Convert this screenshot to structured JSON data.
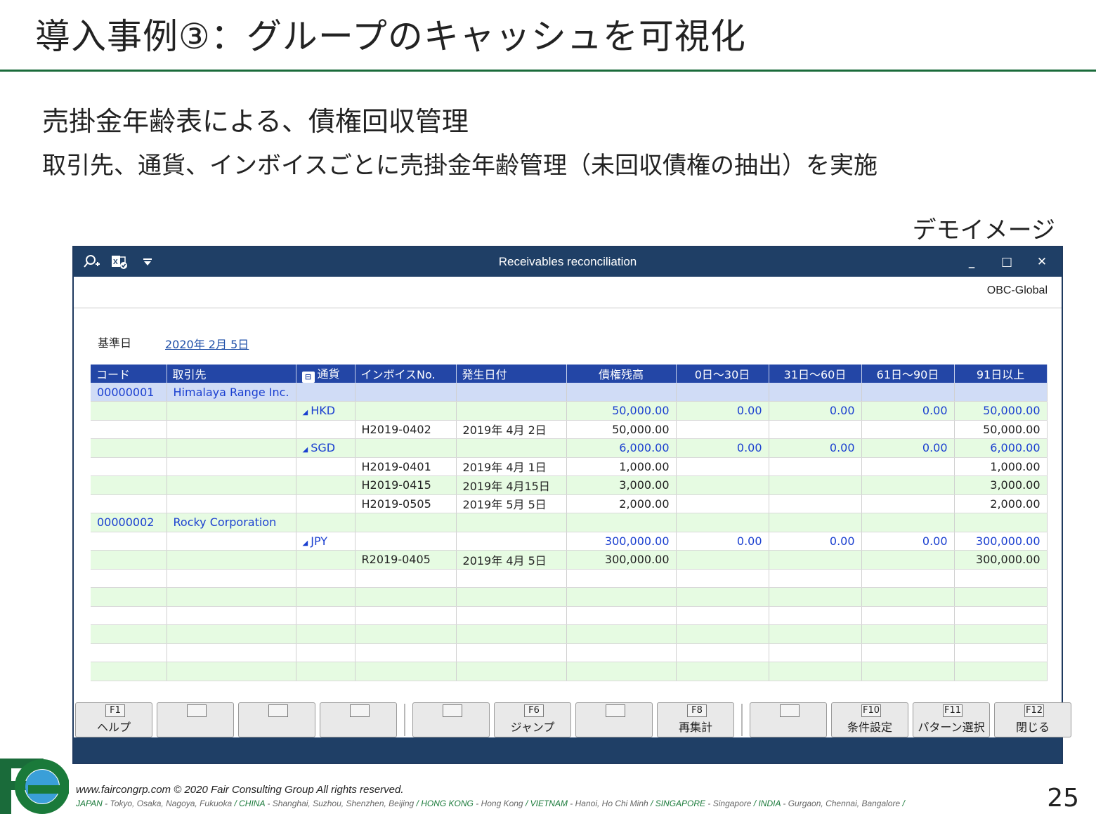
{
  "slide": {
    "title": "導入事例③：グループのキャッシュを可視化",
    "subheading": "売掛金年齢表による、債権回収管理",
    "description": "取引先、通貨、インボイスごとに売掛金年齢管理（未回収債権の抽出）を実施",
    "demo_label": "デモイメージ",
    "page_number": "25"
  },
  "window": {
    "title": "Receivables reconciliation",
    "company": "OBC-Global",
    "toolbar_icons": [
      "search-plus-icon",
      "excel-export-icon",
      "dropdown-arrow-icon"
    ],
    "controls": {
      "minimize": "_",
      "maximize": "□",
      "close": "✕"
    }
  },
  "filter": {
    "base_date_label": "基準日",
    "base_date_value": "2020年  2月  5日"
  },
  "grid": {
    "headers": [
      "コード",
      "取引先",
      "通貨",
      "インボイスNo.",
      "発生日付",
      "債権残高",
      "0日～30日",
      "31日～60日",
      "61日～90日",
      "91日以上"
    ],
    "rows": [
      {
        "type": "customer",
        "style": "blue",
        "cells": [
          "00000001",
          "Himalaya Range Inc.",
          "",
          "",
          "",
          "",
          "",
          "",
          "",
          ""
        ]
      },
      {
        "type": "currency",
        "style": "green",
        "cells": [
          "",
          "",
          "HKD",
          "",
          "",
          "50,000.00",
          "0.00",
          "0.00",
          "0.00",
          "50,000.00"
        ]
      },
      {
        "type": "invoice",
        "style": "white",
        "cells": [
          "",
          "",
          "",
          "H2019-0402",
          "2019年  4月  2日",
          "50,000.00",
          "",
          "",
          "",
          "50,000.00"
        ]
      },
      {
        "type": "currency",
        "style": "green",
        "cells": [
          "",
          "",
          "SGD",
          "",
          "",
          "6,000.00",
          "0.00",
          "0.00",
          "0.00",
          "6,000.00"
        ]
      },
      {
        "type": "invoice",
        "style": "white",
        "cells": [
          "",
          "",
          "",
          "H2019-0401",
          "2019年  4月  1日",
          "1,000.00",
          "",
          "",
          "",
          "1,000.00"
        ]
      },
      {
        "type": "invoice",
        "style": "green",
        "cells": [
          "",
          "",
          "",
          "H2019-0415",
          "2019年  4月15日",
          "3,000.00",
          "",
          "",
          "",
          "3,000.00"
        ]
      },
      {
        "type": "invoice",
        "style": "white",
        "cells": [
          "",
          "",
          "",
          "H2019-0505",
          "2019年  5月  5日",
          "2,000.00",
          "",
          "",
          "",
          "2,000.00"
        ]
      },
      {
        "type": "customer",
        "style": "green",
        "cells": [
          "00000002",
          "Rocky Corporation",
          "",
          "",
          "",
          "",
          "",
          "",
          "",
          ""
        ]
      },
      {
        "type": "currency",
        "style": "white",
        "cells": [
          "",
          "",
          "JPY",
          "",
          "",
          "300,000.00",
          "0.00",
          "0.00",
          "0.00",
          "300,000.00"
        ]
      },
      {
        "type": "invoice",
        "style": "green",
        "cells": [
          "",
          "",
          "",
          "R2019-0405",
          "2019年  4月  5日",
          "300,000.00",
          "",
          "",
          "",
          "300,000.00"
        ]
      },
      {
        "type": "empty",
        "style": "white",
        "cells": [
          "",
          "",
          "",
          "",
          "",
          "",
          "",
          "",
          "",
          ""
        ]
      },
      {
        "type": "empty",
        "style": "green",
        "cells": [
          "",
          "",
          "",
          "",
          "",
          "",
          "",
          "",
          "",
          ""
        ]
      },
      {
        "type": "empty",
        "style": "white",
        "cells": [
          "",
          "",
          "",
          "",
          "",
          "",
          "",
          "",
          "",
          ""
        ]
      },
      {
        "type": "empty",
        "style": "green",
        "cells": [
          "",
          "",
          "",
          "",
          "",
          "",
          "",
          "",
          "",
          ""
        ]
      },
      {
        "type": "empty",
        "style": "white",
        "cells": [
          "",
          "",
          "",
          "",
          "",
          "",
          "",
          "",
          "",
          ""
        ]
      },
      {
        "type": "empty",
        "style": "green",
        "cells": [
          "",
          "",
          "",
          "",
          "",
          "",
          "",
          "",
          "",
          ""
        ]
      }
    ]
  },
  "function_keys": [
    {
      "key": "F1",
      "label": "ヘルプ"
    },
    {
      "key": "",
      "label": ""
    },
    {
      "key": "",
      "label": ""
    },
    {
      "key": "",
      "label": ""
    },
    {
      "key": "",
      "label": ""
    },
    {
      "key": "F6",
      "label": "ジャンプ"
    },
    {
      "key": "",
      "label": ""
    },
    {
      "key": "F8",
      "label": "再集計"
    },
    {
      "key": "",
      "label": ""
    },
    {
      "key": "F10",
      "label": "条件設定"
    },
    {
      "key": "F11",
      "label": "パターン選択"
    },
    {
      "key": "F12",
      "label": "閉じる"
    }
  ],
  "footer": {
    "copyright": "www.faircongrp.com © 2020 Fair Consulting Group All rights reserved.",
    "locations": [
      {
        "country": "JAPAN",
        "cities": "Tokyo, Osaka, Nagoya, Fukuoka"
      },
      {
        "country": "CHINA",
        "cities": "Shanghai, Suzhou, Shenzhen, Beijing"
      },
      {
        "country": "HONG KONG",
        "cities": "Hong Kong"
      },
      {
        "country": "VIETNAM",
        "cities": "Hanoi, Ho Chi Minh"
      },
      {
        "country": "SINGAPORE",
        "cities": "Singapore"
      },
      {
        "country": "INDIA",
        "cities": "Gurgaon, Chennai, Bangalore"
      }
    ]
  },
  "colors": {
    "accent_green": "#1a6b3a",
    "titlebar": "#1f3f66",
    "grid_header": "#2346a6",
    "row_green": "#e6fbe2",
    "row_blue": "#d0dcf6"
  }
}
